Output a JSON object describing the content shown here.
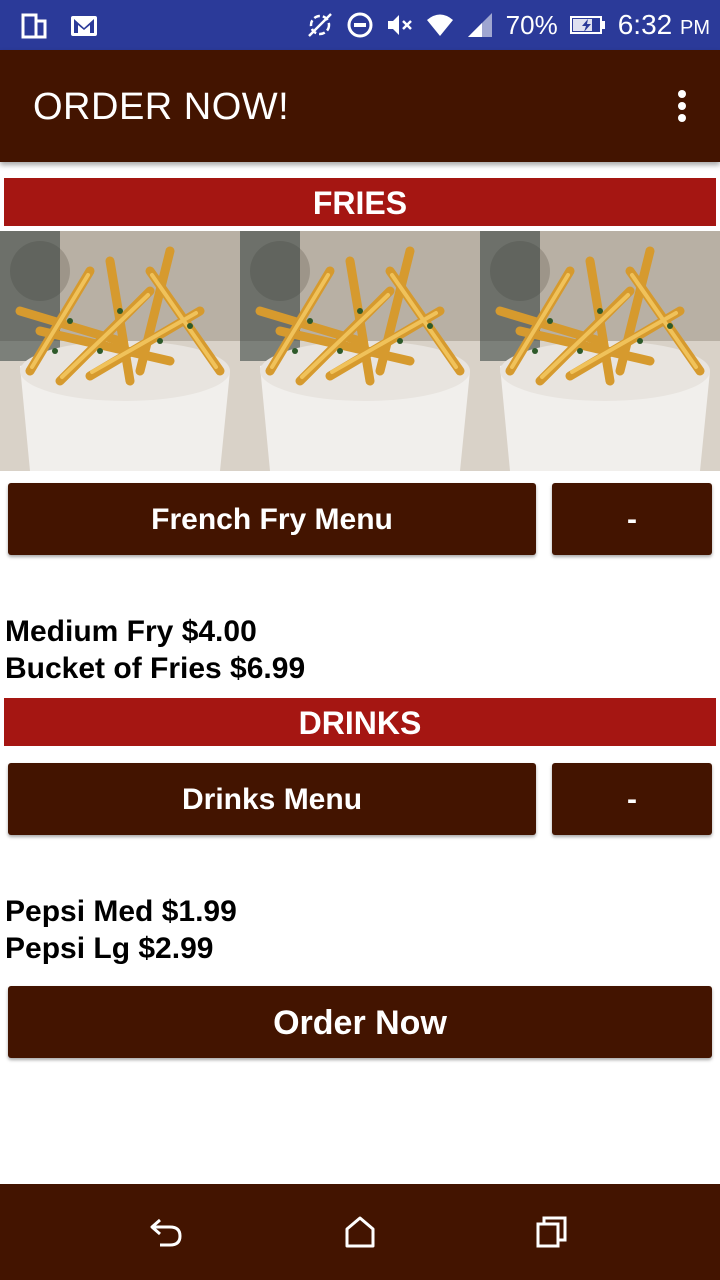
{
  "status_bar": {
    "battery_percent": "70%",
    "time": "6:32",
    "time_suffix": "PM",
    "left_icons": [
      "phone-icon",
      "gmail-icon"
    ],
    "right_icons": [
      "sync-disabled-icon",
      "do-not-disturb-icon",
      "mute-icon",
      "wifi-icon",
      "cell-signal-icon",
      "battery-charging-icon"
    ]
  },
  "app_bar": {
    "title": "ORDER NOW!",
    "overflow_icon": "more-vert-icon"
  },
  "sections": {
    "fries": {
      "header": "FRIES",
      "menu_button": "French Fry Menu",
      "collapse_button": "-",
      "items": [
        "Medium Fry $4.00",
        "Bucket of Fries $6.99"
      ]
    },
    "drinks": {
      "header": "DRINKS",
      "menu_button": "Drinks Menu",
      "collapse_button": "-",
      "items": [
        "Pepsi Med $1.99",
        "Pepsi Lg $2.99"
      ]
    }
  },
  "order_button": "Order Now",
  "nav_bar": {
    "icons": [
      "back-icon",
      "home-icon",
      "recents-icon"
    ]
  },
  "colors": {
    "status_bar": "#2b3a99",
    "primary_dark": "#431400",
    "section_red": "#a51612",
    "text": "#000000"
  }
}
